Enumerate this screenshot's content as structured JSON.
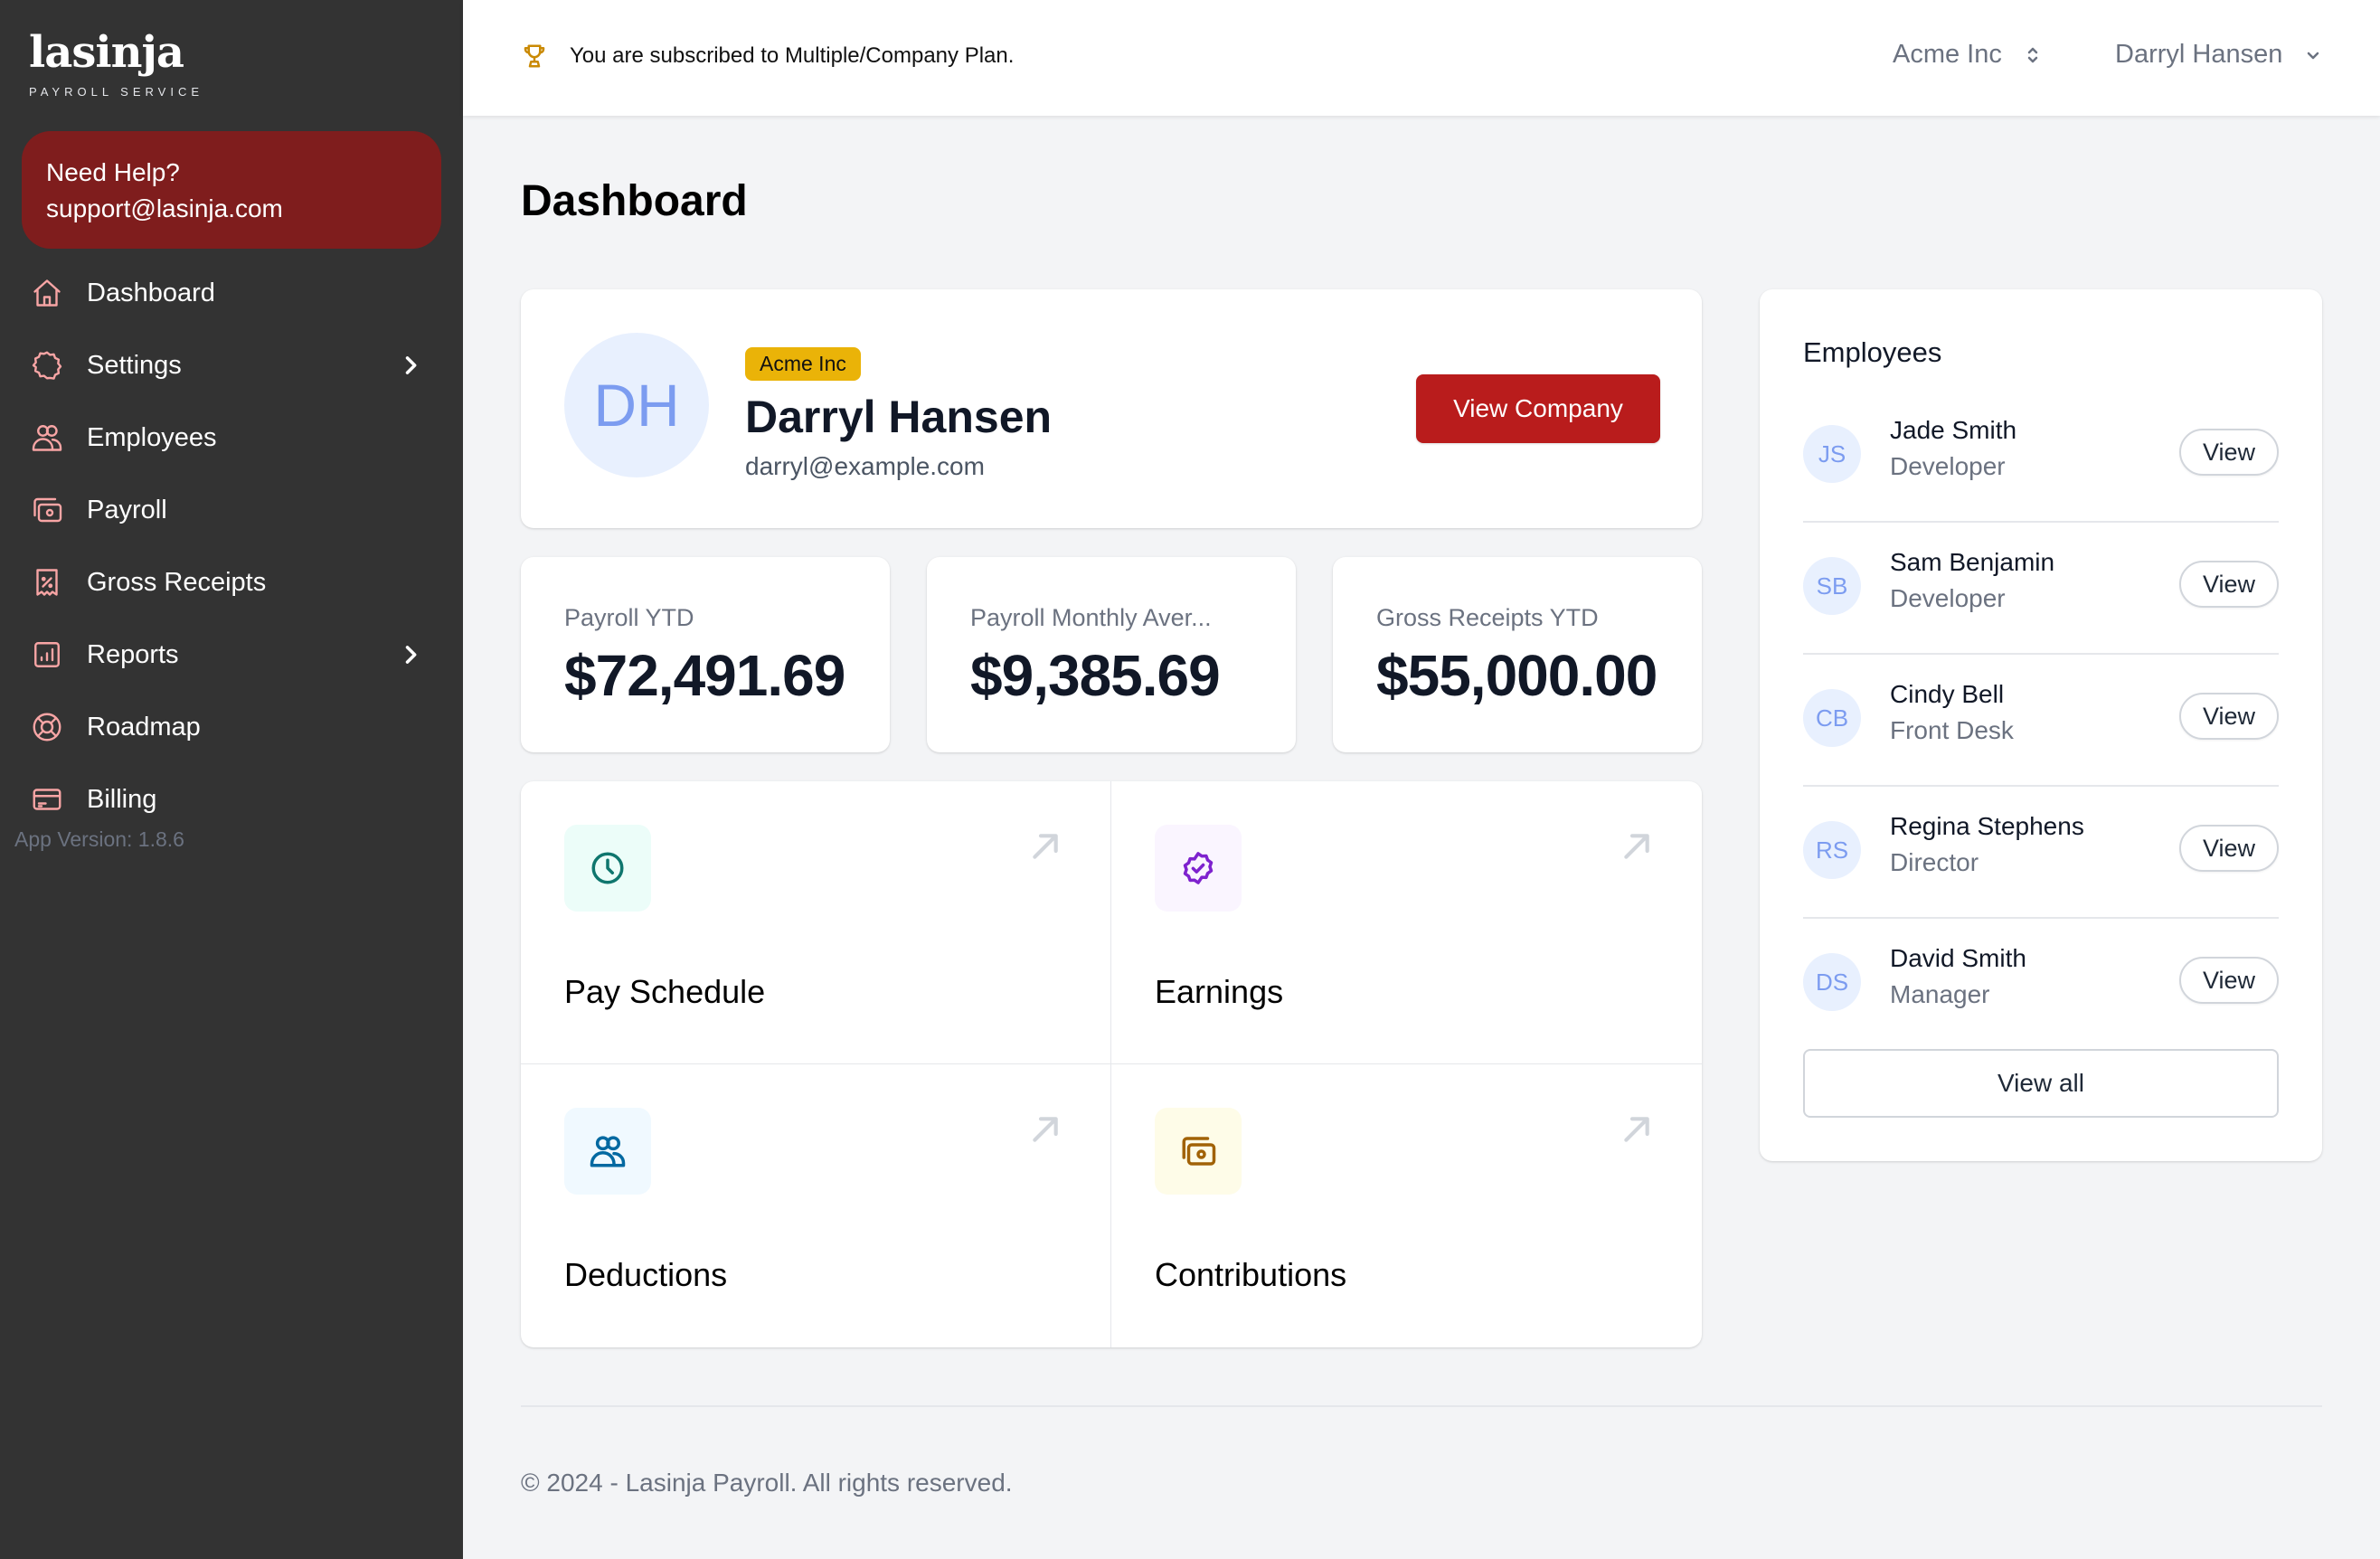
{
  "brand": {
    "name": "lasinja",
    "tagline": "PAYROLL SERVICE"
  },
  "help": {
    "title": "Need Help?",
    "email": "support@lasinja.com"
  },
  "sidebar": {
    "items": [
      {
        "label": "Dashboard",
        "icon": "home-icon",
        "has_chevron": false
      },
      {
        "label": "Settings",
        "icon": "gear-icon",
        "has_chevron": true
      },
      {
        "label": "Employees",
        "icon": "users-icon",
        "has_chevron": false
      },
      {
        "label": "Payroll",
        "icon": "cash-icon",
        "has_chevron": false
      },
      {
        "label": "Gross Receipts",
        "icon": "receipt-percent-icon",
        "has_chevron": false
      },
      {
        "label": "Reports",
        "icon": "chart-bar-icon",
        "has_chevron": true
      },
      {
        "label": "Roadmap",
        "icon": "lifebuoy-icon",
        "has_chevron": false
      },
      {
        "label": "Billing",
        "icon": "credit-card-icon",
        "has_chevron": false
      }
    ],
    "version": "App Version: 1.8.6",
    "icon_color": "#f8a5a5"
  },
  "header": {
    "plan_notice": "You are subscribed to Multiple/Company Plan.",
    "plan_icon": "trophy-icon",
    "company_selector": "Acme Inc",
    "user_menu": "Darryl Hansen"
  },
  "page": {
    "title": "Dashboard"
  },
  "profile": {
    "initials": "DH",
    "company_badge": "Acme Inc",
    "name": "Darryl Hansen",
    "email": "darryl@example.com",
    "view_company_label": "View Company"
  },
  "stats": [
    {
      "label": "Payroll YTD",
      "value": "$72,491.69"
    },
    {
      "label": "Payroll Monthly Aver...",
      "value": "$9,385.69"
    },
    {
      "label": "Gross Receipts YTD",
      "value": "$55,000.00"
    }
  ],
  "tiles": [
    {
      "label": "Pay Schedule",
      "icon": "clock-icon",
      "color": "#0f766e",
      "bg": "#ecfdf9"
    },
    {
      "label": "Earnings",
      "icon": "badge-check-icon",
      "color": "#7e22ce",
      "bg": "#faf5ff"
    },
    {
      "label": "Deductions",
      "icon": "users-icon",
      "color": "#0369a1",
      "bg": "#f0f9ff"
    },
    {
      "label": "Contributions",
      "icon": "cash-icon",
      "color": "#a16207",
      "bg": "#fefce8"
    }
  ],
  "employees": {
    "title": "Employees",
    "items": [
      {
        "initials": "JS",
        "name": "Jade Smith",
        "role": "Developer",
        "action": "View"
      },
      {
        "initials": "SB",
        "name": "Sam Benjamin",
        "role": "Developer",
        "action": "View"
      },
      {
        "initials": "CB",
        "name": "Cindy Bell",
        "role": "Front Desk",
        "action": "View"
      },
      {
        "initials": "RS",
        "name": "Regina Stephens",
        "role": "Director",
        "action": "View"
      },
      {
        "initials": "DS",
        "name": "David Smith",
        "role": "Manager",
        "action": "View"
      }
    ],
    "view_all_label": "View all"
  },
  "footer": {
    "text": "© 2024 - Lasinja Payroll. All rights reserved."
  },
  "colors": {
    "sidebar_bg": "#333333",
    "help_bg": "#7f1d1d",
    "primary_button": "#b91c1c",
    "badge": "#eab308"
  }
}
